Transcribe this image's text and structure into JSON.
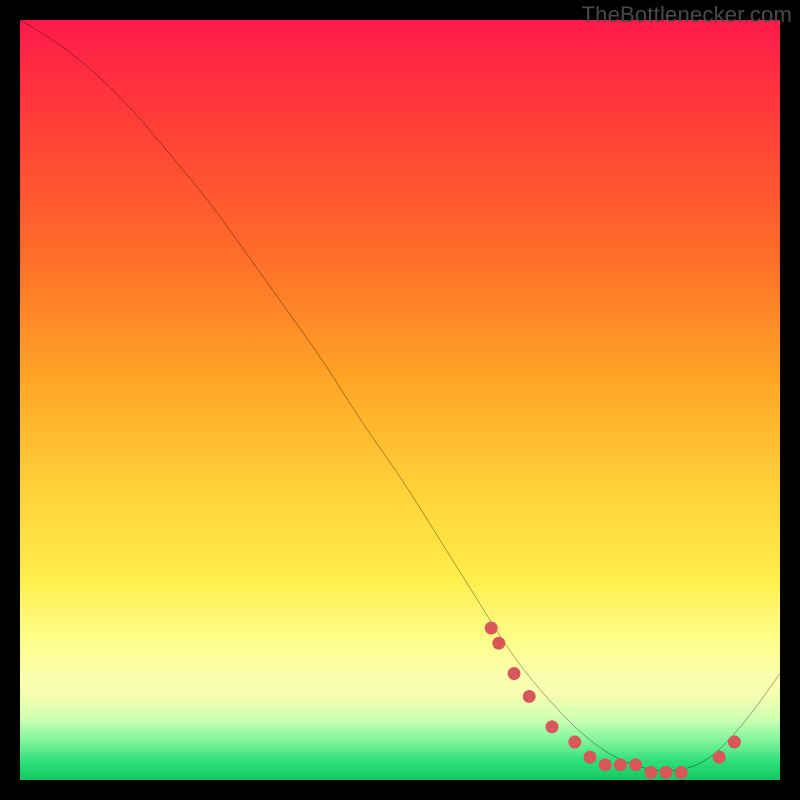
{
  "watermark": "TheBottlenecker.com",
  "chart_data": {
    "type": "line",
    "title": "",
    "xlabel": "",
    "ylabel": "",
    "xlim": [
      0,
      100
    ],
    "ylim": [
      0,
      100
    ],
    "series": [
      {
        "name": "bottleneck-curve",
        "x": [
          0,
          5,
          10,
          15,
          20,
          25,
          30,
          35,
          40,
          45,
          50,
          55,
          60,
          65,
          70,
          75,
          80,
          85,
          90,
          95,
          100
        ],
        "values": [
          100,
          97,
          93,
          88,
          82,
          76,
          69,
          62,
          55,
          47,
          40,
          32,
          24,
          16,
          10,
          5,
          2,
          1,
          2,
          7,
          14
        ]
      }
    ],
    "markers": {
      "name": "highlight-dots",
      "color": "#d9565b",
      "x": [
        62,
        63,
        65,
        67,
        70,
        73,
        75,
        77,
        79,
        81,
        83,
        85,
        87,
        92,
        94
      ],
      "values": [
        20,
        18,
        14,
        11,
        7,
        5,
        3,
        2,
        2,
        2,
        1,
        1,
        1,
        3,
        5
      ]
    },
    "background_gradient": {
      "top": "#ff1a4b",
      "mid": "#ffd23a",
      "bottom": "#11c95e"
    }
  }
}
